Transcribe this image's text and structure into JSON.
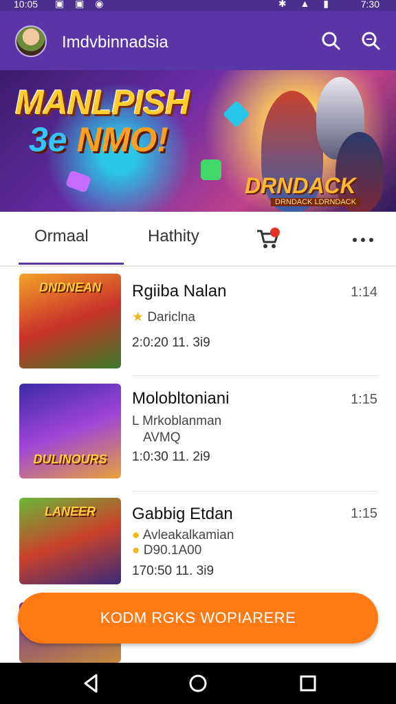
{
  "status_bar": {
    "time": "10:05",
    "clock": "7:30"
  },
  "app_bar": {
    "title": "Imdvbinnadsia"
  },
  "banner": {
    "headline": "MANLPISH",
    "subline_part1": "3e",
    "subline_part2": " NMO!",
    "logo": "DRNDACK",
    "logo_sub": "DRNDACK LDRNDACK"
  },
  "tabs": [
    {
      "label": "Ormaal"
    },
    {
      "label": "Hathity"
    },
    {
      "label": "more"
    }
  ],
  "items": [
    {
      "title": "Rgiiba Nalan",
      "sub1": "Dariclna",
      "date": "2:0:20 11. 3i9",
      "time": "1:14",
      "thumb_title": "DNDNEAN"
    },
    {
      "title": "Molobltoniani",
      "sub1": "L Mrkoblanman",
      "sub2": "AVMQ",
      "date": "1:0:30 11. 2i9",
      "time": "1:15",
      "thumb_title": "DULINOURS"
    },
    {
      "title": "Gabbig Etdan",
      "sub1": "Avleakalkamian",
      "sub2": "D90.1A00",
      "date": "170:50 11. 3i9",
      "time": "1:15",
      "thumb_title": "LANEER"
    }
  ],
  "cta": {
    "label": "KODM RGKS WOPIARERE"
  },
  "colors": {
    "primary": "#5a35a6",
    "accent": "#ff7a12"
  }
}
